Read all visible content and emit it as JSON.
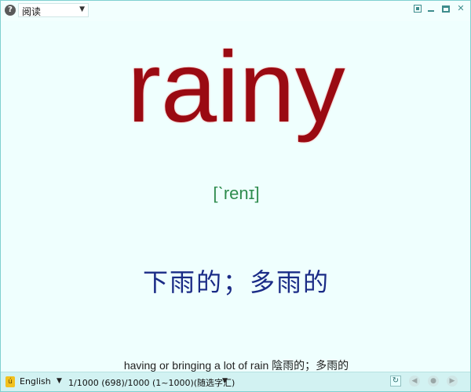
{
  "topbar": {
    "help_icon": "question-circle-icon",
    "mode_label": "阅读"
  },
  "entry": {
    "word": "rainy",
    "phonetic": "[ˋrenɪ]",
    "meaning": "下雨的；多雨的",
    "definition": "having or bringing a lot of rain 陰雨的；多雨的"
  },
  "statusbar": {
    "language": "English",
    "progress_text": "1/1000 (698)/1000 (1~1000)(随选字汇)"
  },
  "colors": {
    "word": "#9a0a12",
    "phonetic": "#2f8c4e",
    "meaning": "#1a2b86",
    "background": "#effffe"
  }
}
